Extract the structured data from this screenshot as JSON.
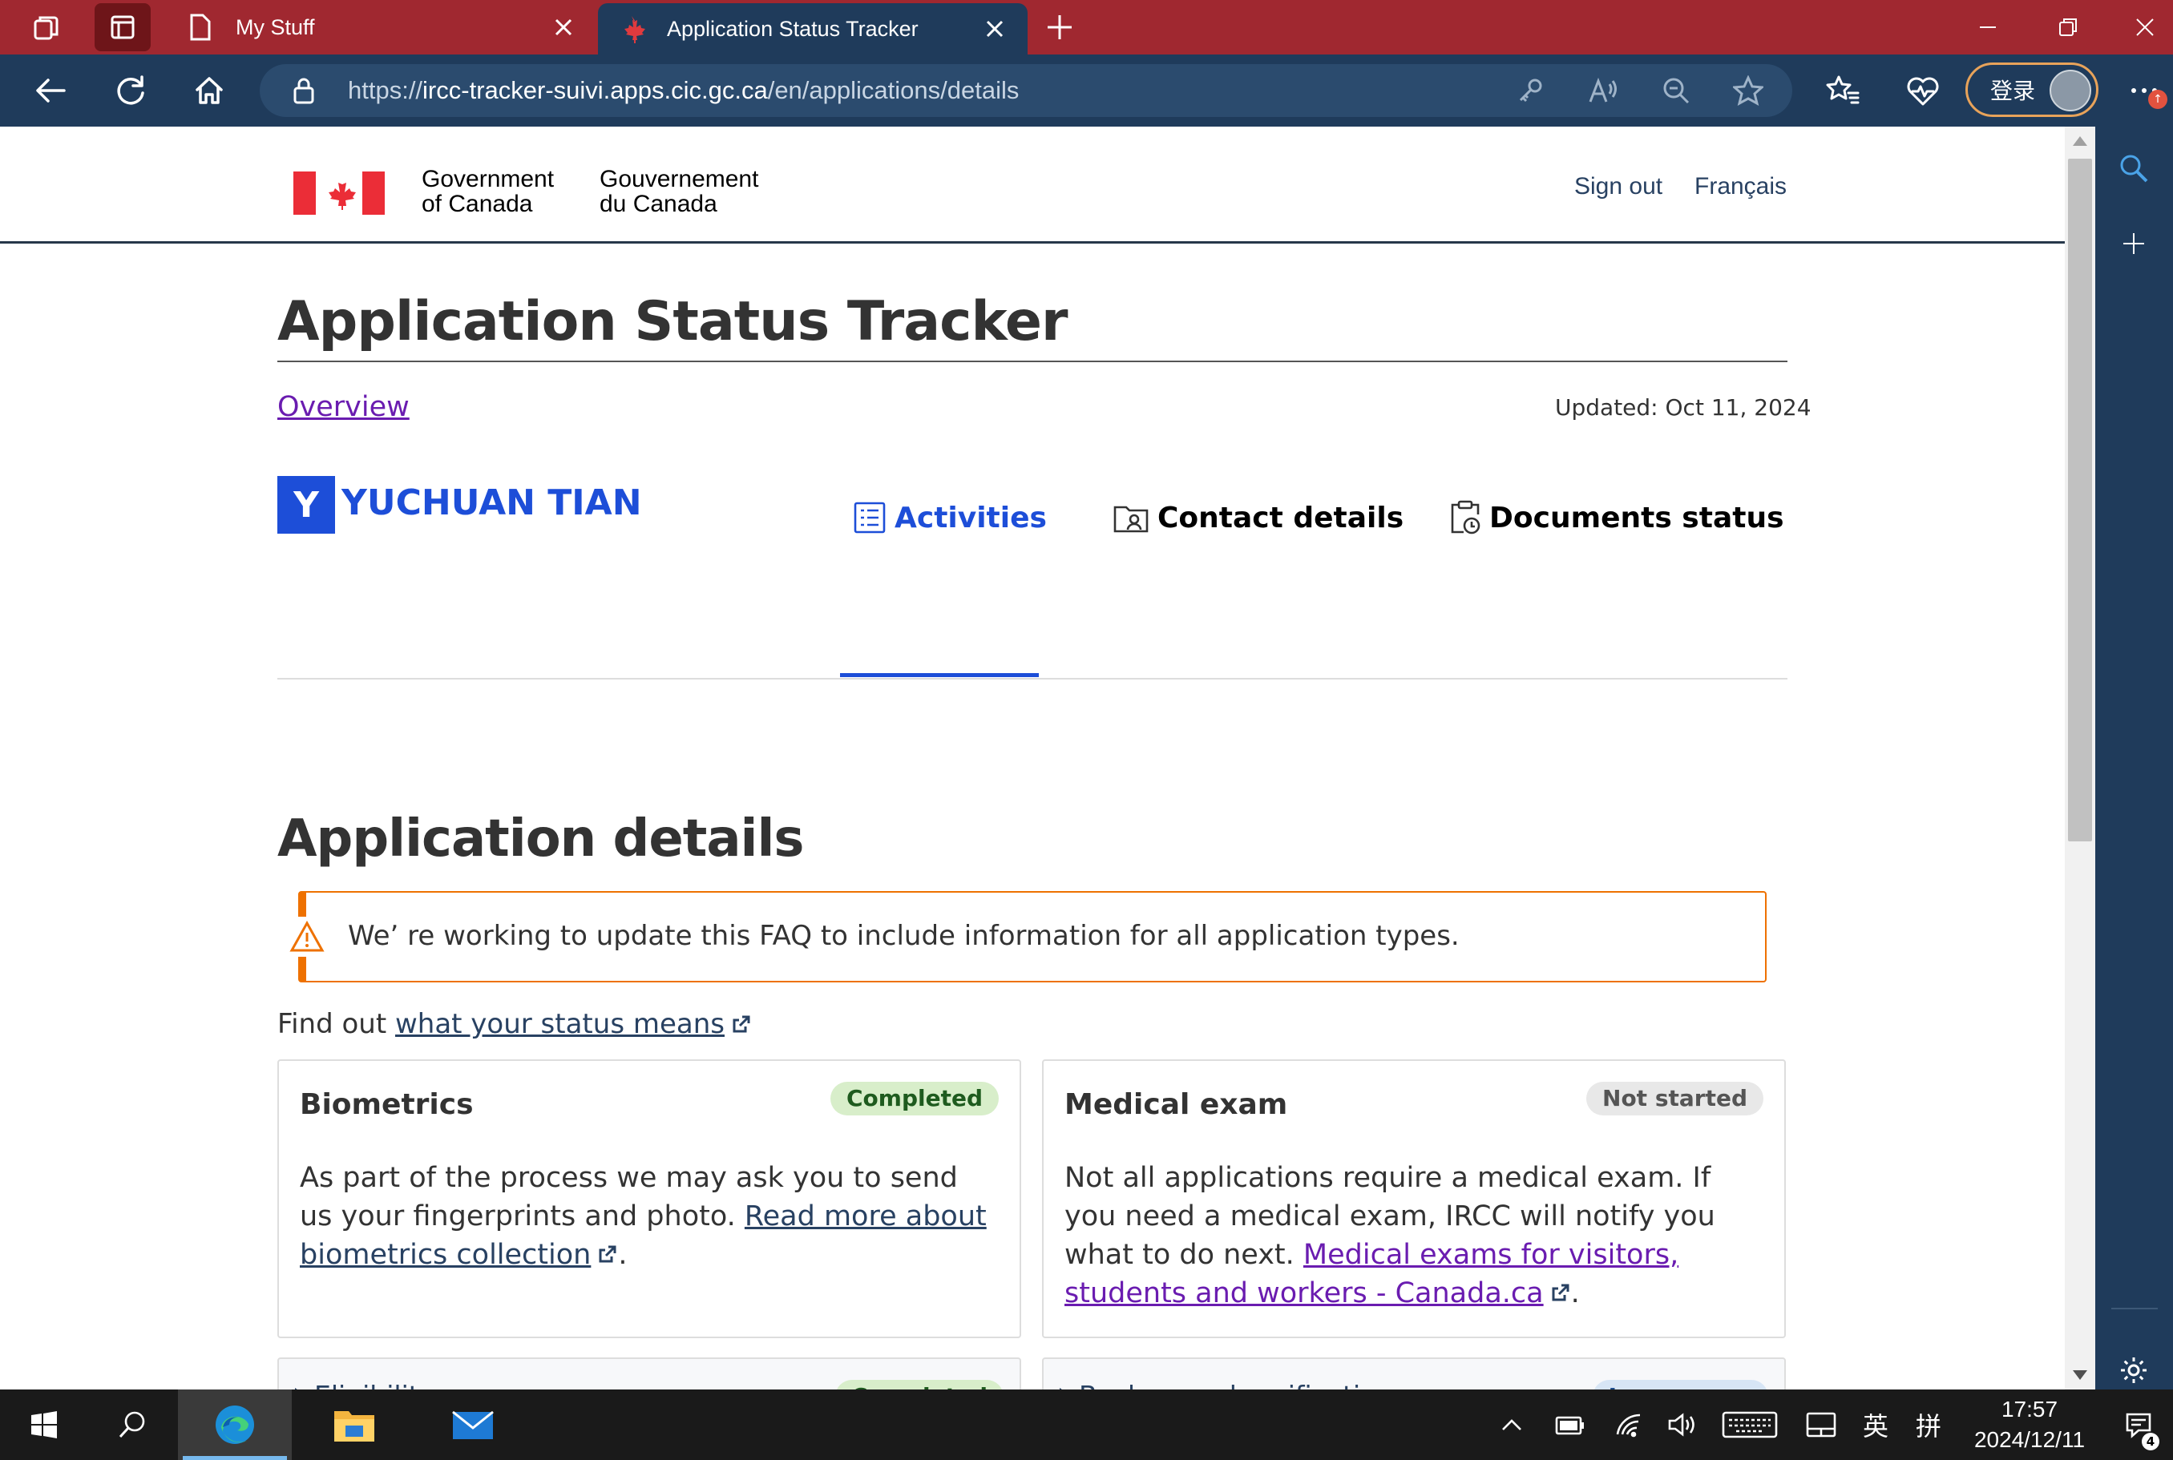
{
  "browser": {
    "tabs": [
      {
        "title": "My Stuff",
        "active": false
      },
      {
        "title": "Application Status Tracker",
        "active": true
      }
    ],
    "url": {
      "prefix": "https://",
      "host": "ircc-tracker-suivi.apps.cic.gc.ca",
      "path": "/en/applications/details"
    },
    "signin_label": "登录",
    "notification_badge": "↑"
  },
  "gc_header": {
    "name_en_line1": "Government",
    "name_en_line2": "of Canada",
    "name_fr_line1": "Gouvernement",
    "name_fr_line2": "du Canada",
    "signout": "Sign out",
    "language": "Français"
  },
  "page": {
    "title": "Application Status Tracker",
    "overview_link": "Overview",
    "updated": "Updated: Oct 11, 2024",
    "user_initial": "Y",
    "user_name": "YUCHUAN TIAN",
    "tabs": [
      {
        "label": "Activities",
        "active": true
      },
      {
        "label": "Contact details",
        "active": false
      },
      {
        "label": "Documents status",
        "active": false
      }
    ],
    "section_title": "Application details",
    "alert_text": "We’ re working to update this FAQ to include information for all application types.",
    "findout_prefix": "Find out ",
    "findout_link": "what your status means",
    "cards": [
      {
        "title": "Biometrics",
        "status": "Completed",
        "body": "As part of the process we may ask you to send us your fingerprints and photo. ",
        "link": "Read more about biometrics collection",
        "suffix": "."
      },
      {
        "title": "Medical exam",
        "status": "Not started",
        "body": "Not all applications require a medical exam. If you need a medical exam, IRCC will notify you what to do next. ",
        "link": "Medical exams for visitors, students and workers - Canada.ca",
        "suffix": "."
      }
    ],
    "accordions": [
      {
        "label": "Eligibility",
        "status": "Completed"
      },
      {
        "label": "Background verification",
        "status": "In progress"
      }
    ]
  },
  "taskbar": {
    "time": "17:57",
    "date": "2024/12/11",
    "lang_indicator": "英",
    "ime_indicator": "拼",
    "notification_count": "4"
  },
  "colors": {
    "titlebar": "#a02830",
    "toolbar": "#1f3b5b",
    "link": "#284162",
    "visited_link": "#6a1cb0",
    "accent_blue": "#1d4ed8",
    "warning": "#ee7100"
  }
}
